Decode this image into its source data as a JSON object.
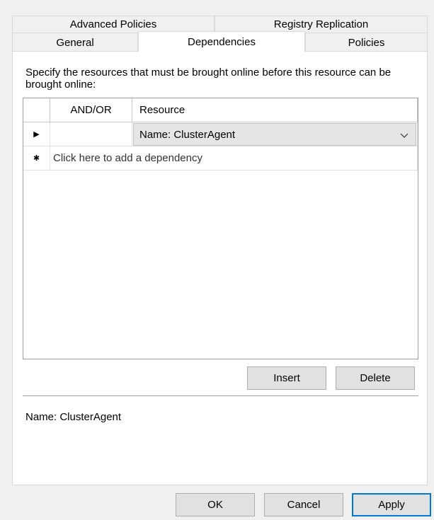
{
  "tabs": {
    "row1": [
      {
        "label": "Advanced Policies"
      },
      {
        "label": "Registry Replication"
      }
    ],
    "row2": [
      {
        "label": "General"
      },
      {
        "label": "Dependencies",
        "selected": true
      },
      {
        "label": "Policies"
      }
    ]
  },
  "dependencies": {
    "description": "Specify the resources that must be brought online before this resource can be brought online:",
    "grid": {
      "columns": [
        "",
        "AND/OR",
        "Resource"
      ],
      "rows": [
        {
          "row_marker": "▶",
          "and_or": "",
          "resource": "Name: ClusterAgent"
        }
      ],
      "new_row": {
        "row_marker": "✱",
        "placeholder": "Click here to add a dependency"
      }
    },
    "insert_label": "Insert",
    "delete_label": "Delete",
    "detail_text": "Name: ClusterAgent"
  },
  "footer": {
    "ok_label": "OK",
    "cancel_label": "Cancel",
    "apply_label": "Apply"
  },
  "colors": {
    "accent": "#0078d7",
    "page_background": "#ffffff",
    "window_background": "#f0f0f0"
  }
}
